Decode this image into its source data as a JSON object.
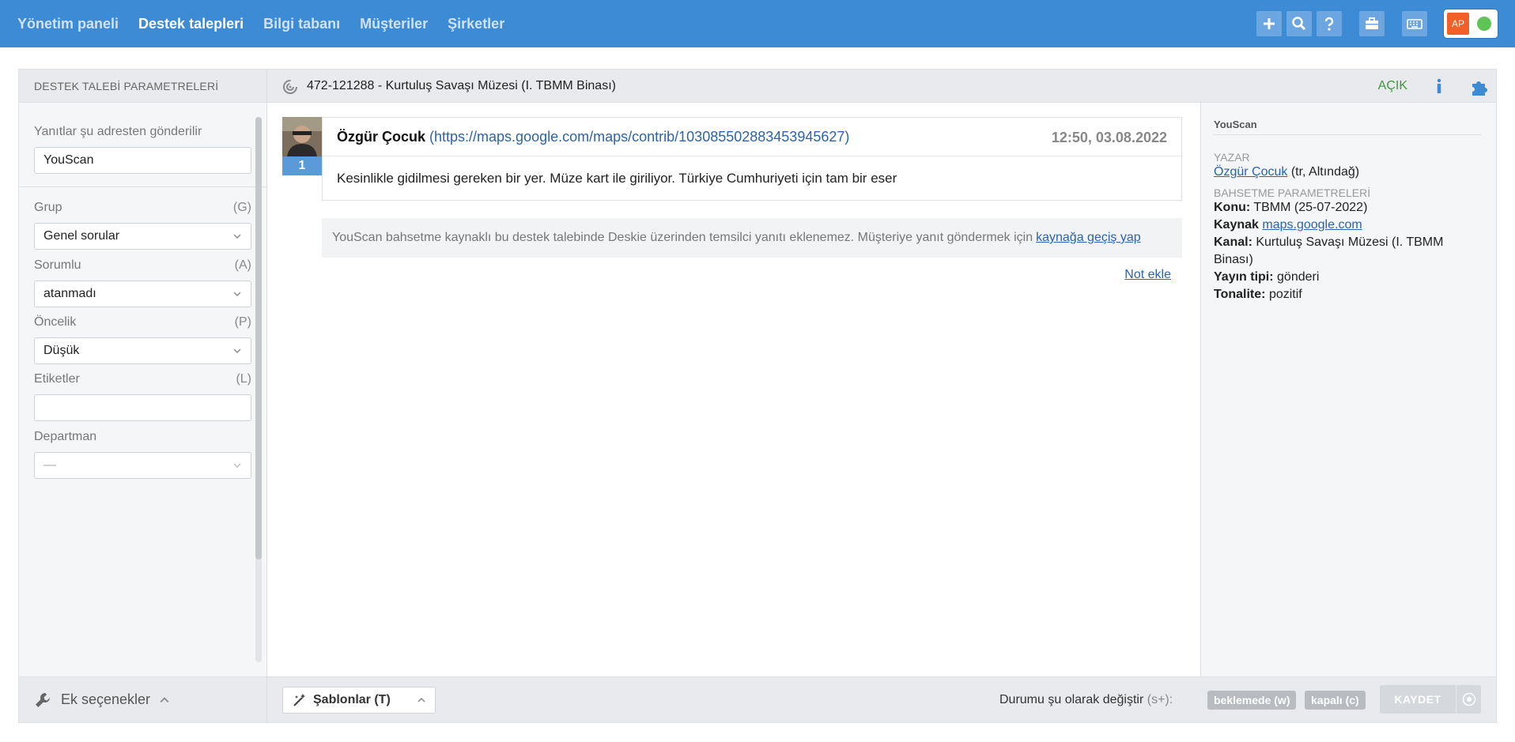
{
  "nav": {
    "items": [
      {
        "label": "Yönetim paneli",
        "active": false
      },
      {
        "label": "Destek talepleri",
        "active": true
      },
      {
        "label": "Bilgi tabanı",
        "active": false
      },
      {
        "label": "Müşteriler",
        "active": false
      },
      {
        "label": "Şirketler",
        "active": false
      }
    ],
    "icons": [
      "plus-icon",
      "search-icon",
      "help-icon",
      "briefcase-icon",
      "keyboard-icon"
    ],
    "user_initials": "AP"
  },
  "colors": {
    "topbar": "#3d8bd4",
    "avatar": "#f06028",
    "online": "#5ec456",
    "link": "#2d62b0",
    "status_open": "#3c9a3c"
  },
  "sidebar": {
    "title": "DESTEK TALEBİ PARAMETRELERİ",
    "reply_from_label": "Yanıtlar şu adresten gönderilir",
    "reply_from_value": "YouScan",
    "fields": [
      {
        "label": "Grup",
        "key": "(G)",
        "value": "Genel sorular"
      },
      {
        "label": "Sorumlu",
        "key": "(A)",
        "value": "atanmadı"
      },
      {
        "label": "Öncelik",
        "key": "(P)",
        "value": "Düşük"
      },
      {
        "label": "Etiketler",
        "key": "(L)",
        "value": ""
      },
      {
        "label": "Departman",
        "key": "",
        "value": "—"
      }
    ],
    "footer_label": "Ek seçenekler"
  },
  "ticket": {
    "title": "472-121288 - Kurtuluş Savaşı Müzesi (I. TBMM Binası)",
    "status": "AÇIK"
  },
  "message": {
    "number": "1",
    "author": "Özgür Çocuk",
    "link": "(https://maps.google.com/maps/contrib/103085502883453945627)",
    "time": "12:50, 03.08.2022",
    "body": "Kesinlikle gidilmesi gereken bir yer. Müze kart ile giriliyor. Türkiye Cumhuriyeti için tam bir eser"
  },
  "notice": {
    "text": "YouScan bahsetme kaynaklı bu destek talebinde Deskie üzerinden temsilci yanıtı eklenemez. Müşteriye yanıt göndermek için",
    "link": "kaynağa geçiş yap"
  },
  "note_add": "Not ekle",
  "right_panel": {
    "title": "YouScan",
    "author_section": "YAZAR",
    "author_name": "Özgür Çocuk",
    "author_meta": "(tr, Altındağ)",
    "mention_section": "BAHSETME PARAMETRELERİ",
    "topic_key": "Konu:",
    "topic_value": "TBMM (25-07-2022)",
    "source_key": "Kaynak",
    "source_value": "maps.google.com",
    "channel_key": "Kanal:",
    "channel_value": "Kurtuluş Savaşı Müzesi (I. TBMM Binası)",
    "pubtype_key": "Yayın tipi:",
    "pubtype_value": "gönderi",
    "tonality_key": "Tonalite:",
    "tonality_value": "pozitif"
  },
  "bottom": {
    "templates_label": "Şablonlar (T)",
    "status_change_label": "Durumu şu olarak değiştir",
    "status_change_hint": "(s+):",
    "pending_label": "beklemede (w)",
    "closed_label": "kapalı (c)",
    "save_label": "KAYDET"
  }
}
